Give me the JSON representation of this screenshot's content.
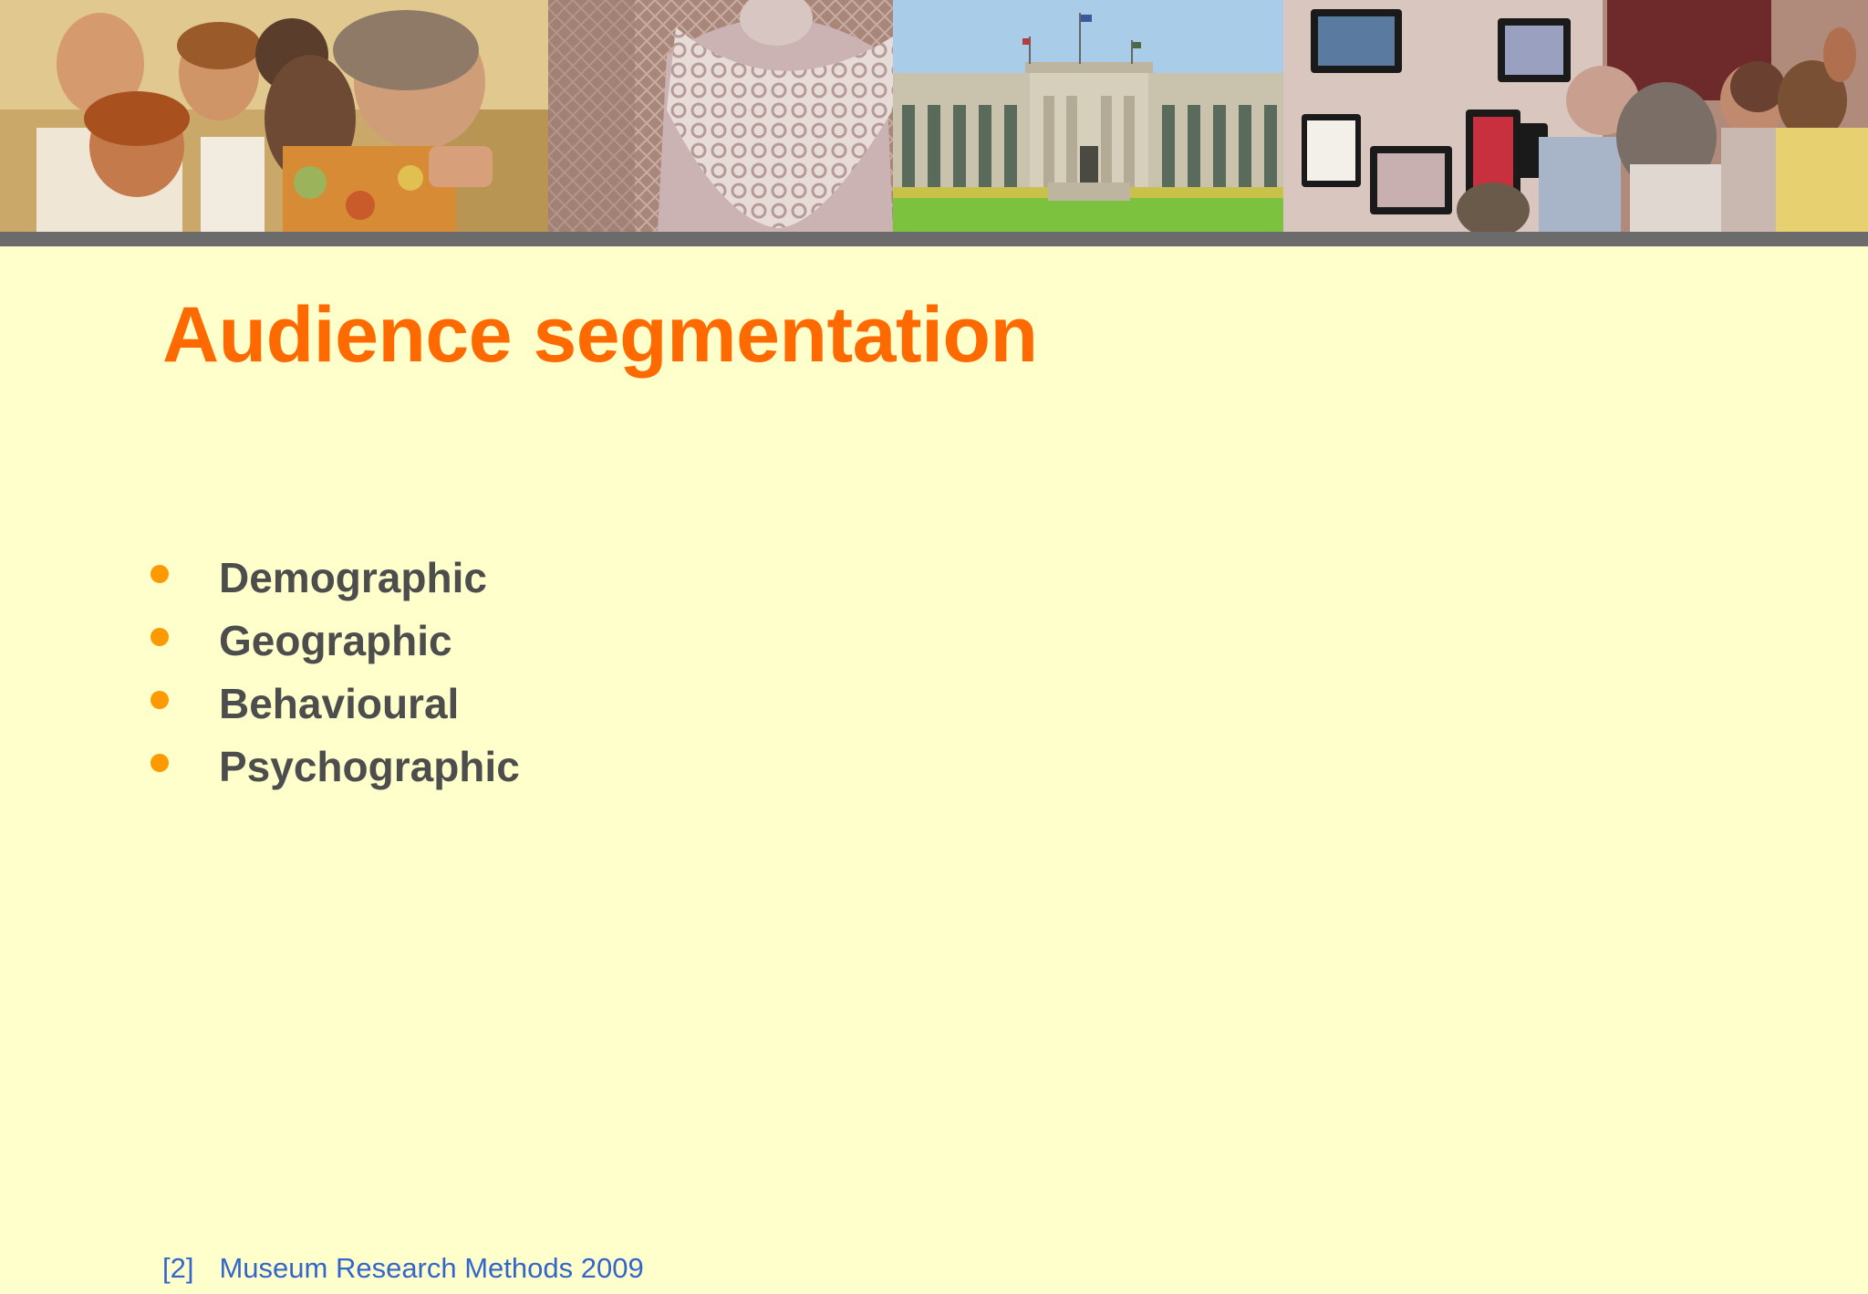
{
  "slide": {
    "title": "Audience segmentation",
    "bullets": [
      "Demographic",
      "Geographic",
      "Behavioural",
      "Psychographic"
    ],
    "footer": {
      "ref": "[2]",
      "text": "Museum Research Methods 2009"
    }
  },
  "banner": {
    "photos": [
      "visitors-tasting-photo",
      "lace-garment-photo",
      "museum-building-photo",
      "screens-exhibition-photo"
    ]
  },
  "colors": {
    "background": "#ffffcc",
    "title": "#ff6a00",
    "bullet": "#ff9900",
    "body_text": "#4d4d4d",
    "footer_text": "#3366cc",
    "banner_rule": "#6b6b6b"
  }
}
